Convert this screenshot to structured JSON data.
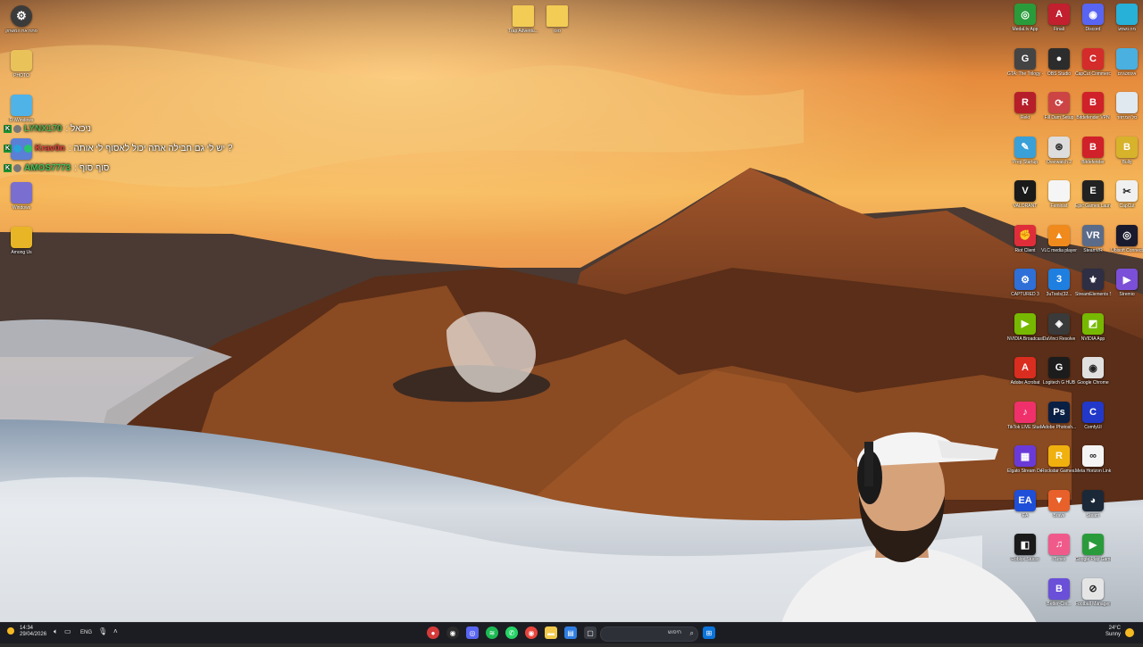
{
  "colors": {
    "sky_top": "#f2b04a",
    "sky_mid": "#e07a2a",
    "mountain": "#7a3d1f",
    "cloud": "#e9ecef",
    "taskbar": "#1c1d22",
    "chat_badge": "#1f9b36"
  },
  "left_icons": [
    {
      "label": "פתח את המשחק",
      "icon": "steam-round-icon",
      "color": "#3b3b3b",
      "glyph": "⚙"
    },
    {
      "label": "PHOTO",
      "icon": "folder-icon",
      "color": "#e9c25a",
      "glyph": ""
    },
    {
      "label": "D:\\Windows",
      "icon": "drive-icon",
      "color": "#4fb3e8",
      "glyph": ""
    },
    {
      "label": "",
      "icon": "app-icon",
      "color": "#5a7fd6",
      "glyph": ""
    },
    {
      "label": "Windows",
      "icon": "windows-app-icon",
      "color": "#7a6fd0",
      "glyph": ""
    },
    {
      "label": "Among Us",
      "icon": "among-us-icon",
      "color": "#e8b526",
      "glyph": ""
    }
  ],
  "top_folders": [
    {
      "label": "Trap Adventu...",
      "icon": "folder-icon"
    },
    {
      "label": "סוס",
      "icon": "folder-icon"
    }
  ],
  "right_icons": [
    [
      {
        "label": "Medal.tv App",
        "color": "#2a9b3a",
        "glyph": "◎"
      },
      {
        "label": "Finali",
        "color": "#c21f2f",
        "glyph": "A"
      },
      {
        "label": "Discord",
        "color": "#5865f2",
        "glyph": "◉"
      },
      {
        "label": "מה נשמע",
        "color": "#27b0d8",
        "glyph": ""
      }
    ],
    [
      {
        "label": "GTA: The Trilogy - DE",
        "color": "#444",
        "glyph": "G"
      },
      {
        "label": "OBS Studio",
        "color": "#2c2c2c",
        "glyph": "●"
      },
      {
        "label": "CapCut Commercial",
        "color": "#d42b2b",
        "glyph": "C"
      },
      {
        "label": "אינסטגרם",
        "color": "#4ab0e0",
        "glyph": ""
      }
    ],
    [
      {
        "label": "Rekt",
        "color": "#b61f2a",
        "glyph": "R"
      },
      {
        "label": "Fill Dam Setup",
        "color": "#c44",
        "glyph": "⟳"
      },
      {
        "label": "Bitdefender VPN",
        "color": "#d0202a",
        "glyph": "B"
      },
      {
        "label": "סל המחזור",
        "color": "#e0e8f0",
        "glyph": ""
      }
    ],
    [
      {
        "label": "Prep Startup",
        "color": "#3aa0d8",
        "glyph": "✎"
      },
      {
        "label": "Overwatch 2",
        "color": "#ddd",
        "glyph": "⊛"
      },
      {
        "label": "Bitdefender",
        "color": "#d0202a",
        "glyph": "B"
      },
      {
        "label": "Bully",
        "color": "#d7b22b",
        "glyph": "B"
      }
    ],
    [
      {
        "label": "VALORANT",
        "color": "#1a1a1a",
        "glyph": "V"
      },
      {
        "label": "Feminist",
        "color": "#f5f5f5",
        "glyph": ""
      },
      {
        "label": "Epic Games Launcher",
        "color": "#222",
        "glyph": "E"
      },
      {
        "label": "CapCut",
        "color": "#f0f0f0",
        "glyph": "✂"
      }
    ],
    [
      {
        "label": "Riot Client",
        "color": "#e02d3a",
        "glyph": "✊"
      },
      {
        "label": "VLC media player",
        "color": "#f08a1c",
        "glyph": "▲"
      },
      {
        "label": "SteamVR",
        "color": "#5b6b8a",
        "glyph": "VR"
      },
      {
        "label": "Ubisoft Connect",
        "color": "#1a1a2e",
        "glyph": "◎"
      }
    ],
    [
      {
        "label": "CAPTURED 3",
        "color": "#2e6fd8",
        "glyph": "⚙"
      },
      {
        "label": "3uTools(32...",
        "color": "#1e7fe0",
        "glyph": "3"
      },
      {
        "label": "StreamElements SE.Live",
        "color": "#2e2e44",
        "glyph": "⚜"
      },
      {
        "label": "Stremio",
        "color": "#7b4fd8",
        "glyph": "▶"
      }
    ],
    [
      {
        "label": "NVIDIA Broadcast",
        "color": "#76b900",
        "glyph": "▶"
      },
      {
        "label": "DaVinci Resolve",
        "color": "#3a3a3a",
        "glyph": "◈"
      },
      {
        "label": "NVIDIA App",
        "color": "#76b900",
        "glyph": "◩"
      },
      {
        "label": "",
        "color": "",
        "glyph": ""
      }
    ],
    [
      {
        "label": "Adobe Acrobat",
        "color": "#d92d20",
        "glyph": "A"
      },
      {
        "label": "Logitech G HUB",
        "color": "#1c1c1c",
        "glyph": "G"
      },
      {
        "label": "Google Chrome",
        "color": "#e0e0e0",
        "glyph": "◉"
      },
      {
        "label": "",
        "color": "",
        "glyph": ""
      }
    ],
    [
      {
        "label": "TikTok LIVE Studio",
        "color": "#f0306a",
        "glyph": "♪"
      },
      {
        "label": "Adobe Photosh...",
        "color": "#0a1f44",
        "glyph": "Ps"
      },
      {
        "label": "ComfyUI",
        "color": "#2238c8",
        "glyph": "C"
      },
      {
        "label": "",
        "color": "",
        "glyph": ""
      }
    ],
    [
      {
        "label": "Elgato Stream Deck",
        "color": "#6a3ad8",
        "glyph": "▦"
      },
      {
        "label": "Rockstar Games...",
        "color": "#f0b10e",
        "glyph": "R"
      },
      {
        "label": "Meta Horizon Link",
        "color": "#f5f5f5",
        "glyph": "∞"
      },
      {
        "label": "",
        "color": "",
        "glyph": ""
      }
    ],
    [
      {
        "label": "EA",
        "color": "#1e4fd8",
        "glyph": "EA"
      },
      {
        "label": "Brave",
        "color": "#e8602a",
        "glyph": "▼"
      },
      {
        "label": "Steam",
        "color": "#1b2838",
        "glyph": "◕"
      },
      {
        "label": "",
        "color": "",
        "glyph": ""
      }
    ],
    [
      {
        "label": "Roblox Studio",
        "color": "#1a1a1a",
        "glyph": "◧"
      },
      {
        "label": "iTunes",
        "color": "#f05a8a",
        "glyph": "♫"
      },
      {
        "label": "Google Play Games",
        "color": "#2a9b3a",
        "glyph": "▶"
      },
      {
        "label": "",
        "color": "",
        "glyph": ""
      }
    ],
    [
      {
        "label": "",
        "color": "",
        "glyph": ""
      },
      {
        "label": "Better-Cre...",
        "color": "#6a4fd8",
        "glyph": "B"
      },
      {
        "label": "Football Manager 26",
        "color": "#e5e5e5",
        "glyph": "⊘"
      },
      {
        "label": "",
        "color": "",
        "glyph": ""
      }
    ]
  ],
  "chat": [
    {
      "user": "LYNX170",
      "user_color": "#4caf50",
      "message": ": ניכאל"
    },
    {
      "user": "Krav0n",
      "user_color": "#e0403a",
      "message": ": יש לי גם חבילה אתה יכול לאסוף לי אותה ?"
    },
    {
      "user": "AMOS7773",
      "user_color": "#3fbf5a",
      "message": ": סוף סוף"
    }
  ],
  "taskbar": {
    "time": "14:34",
    "date": "29/04/2026",
    "lang": "ENG",
    "search_placeholder": "חיפוש",
    "weather_temp": "24°C",
    "weather_desc": "Sunny"
  }
}
